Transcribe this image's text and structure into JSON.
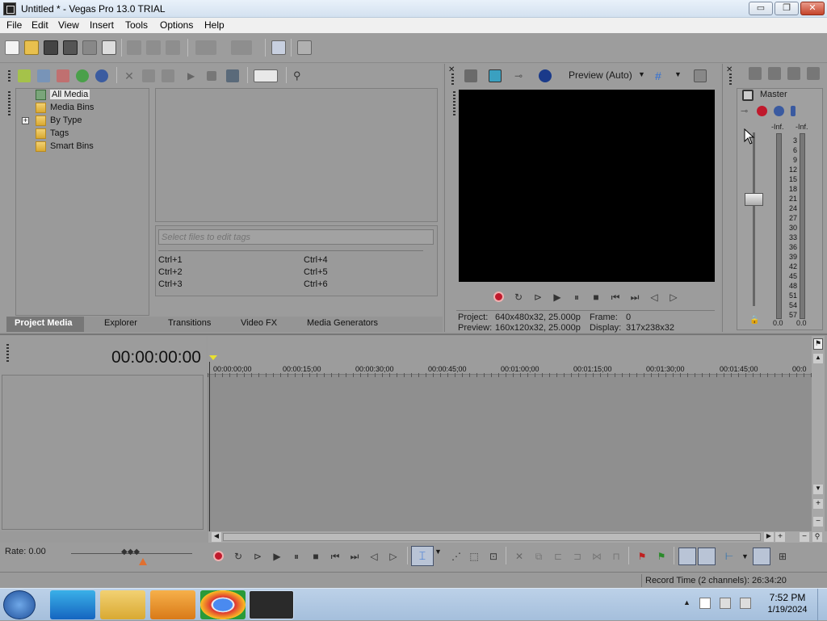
{
  "window": {
    "title": "Untitled * - Vegas Pro 13.0 TRIAL",
    "min_glyph": "▭",
    "max_glyph": "❐",
    "close_glyph": "✕"
  },
  "menu": [
    "File",
    "Edit",
    "View",
    "Insert",
    "Tools",
    "Options",
    "Help"
  ],
  "project_media": {
    "tree": [
      "All Media",
      "Media Bins",
      "By Type",
      "Tags",
      "Smart Bins"
    ],
    "expander": "+",
    "tag_placeholder": "Select files to edit tags",
    "shortcuts": [
      "Ctrl+1",
      "Ctrl+2",
      "Ctrl+3",
      "Ctrl+4",
      "Ctrl+5",
      "Ctrl+6"
    ]
  },
  "tabs": [
    "Project Media",
    "Explorer",
    "Transitions",
    "Video FX",
    "Media Generators"
  ],
  "preview": {
    "mode_label": "Preview (Auto)",
    "project_label": "Project:",
    "project_value": "640x480x32, 25.000p",
    "preview_label": "Preview:",
    "preview_value": "160x120x32, 25.000p",
    "frame_label": "Frame:",
    "frame_value": "0",
    "display_label": "Display:",
    "display_value": "317x238x32"
  },
  "mixer": {
    "master_label": "Master",
    "peak_left": "-Inf.",
    "peak_right": "-Inf.",
    "scale": [
      "3",
      "6",
      "9",
      "12",
      "15",
      "18",
      "21",
      "24",
      "27",
      "30",
      "33",
      "36",
      "39",
      "42",
      "45",
      "48",
      "51",
      "54",
      "57"
    ],
    "bottom_left": "0.0",
    "bottom_right": "0.0"
  },
  "timeline": {
    "timecode": "00:00:00:00",
    "ruler": [
      "00:00:00;00",
      "00:00:15;00",
      "00:00:30;00",
      "00:00:45;00",
      "00:01:00;00",
      "00:01:15;00",
      "00:01:30;00",
      "00:01:45;00",
      "00:0"
    ],
    "rate": "Rate: 0.00"
  },
  "status": {
    "record_time": "Record Time (2 channels): 26:34:20"
  },
  "taskbar": {
    "time": "7:52 PM",
    "date": "1/19/2024"
  },
  "colors": {
    "record": "#c0192c",
    "accent_blue": "#2e6fd6",
    "folder": "#e8c04e"
  }
}
